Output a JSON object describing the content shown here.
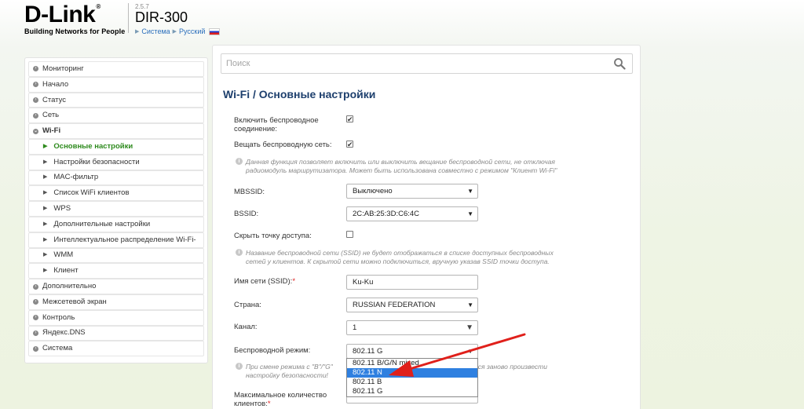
{
  "header": {
    "logo": "D-Link",
    "logo_reg": "®",
    "tagline": "Building Networks for People",
    "version": "2.5.7",
    "model": "DIR-300",
    "link_system": "Система",
    "link_language": "Русский"
  },
  "sidebar": {
    "items": [
      {
        "label": "Мониторинг"
      },
      {
        "label": "Начало"
      },
      {
        "label": "Статус"
      },
      {
        "label": "Сеть"
      },
      {
        "label": "Wi-Fi"
      },
      {
        "label": "Основные настройки"
      },
      {
        "label": "Настройки безопасности"
      },
      {
        "label": "MAC-фильтр"
      },
      {
        "label": "Список WiFi клиентов"
      },
      {
        "label": "WPS"
      },
      {
        "label": "Дополнительные настройки"
      },
      {
        "label": "Интеллектуальное распределение Wi-Fi-"
      },
      {
        "label": "WMM"
      },
      {
        "label": "Клиент"
      },
      {
        "label": "Дополнительно"
      },
      {
        "label": "Межсетевой экран"
      },
      {
        "label": "Контроль"
      },
      {
        "label": "Яндекс.DNS"
      },
      {
        "label": "Система"
      }
    ]
  },
  "search": {
    "placeholder": "Поиск"
  },
  "page": {
    "title": "Wi-Fi /  Основные настройки"
  },
  "form": {
    "enable_label_1": "Включить беспроводное",
    "enable_label_2": "соединение:",
    "enable_checked": "✔",
    "broadcast_label": "Вещать беспроводную сеть:",
    "broadcast_checked": "✔",
    "broadcast_hint_1": "Данная функция позволяет включить или выключить вещание беспроводной сети, не отключая",
    "broadcast_hint_2": "радиомодуль маршрутизатора. Может быть использована совместно с режимом \"Клиент Wi-Fi\"",
    "mbssid_label": "MBSSID:",
    "mbssid_value": "Выключено",
    "bssid_label": "BSSID:",
    "bssid_value": "2C:AB:25:3D:C6:4C",
    "hide_label": "Скрыть точку доступа:",
    "hide_hint_1": "Название беспроводной сети (SSID) не будет отображаться в списке доступных беспроводных",
    "hide_hint_2": "сетей у клиентов. К скрытой сети можно подключиться, вручную указав SSID точки доступа.",
    "ssid_label": "Имя сети (SSID):",
    "ssid_required": "*",
    "ssid_value": "Ku-Ku",
    "country_label": "Страна:",
    "country_value": "RUSSIAN FEDERATION",
    "channel_label": "Канал:",
    "channel_value": "1",
    "mode_label": "Беспроводной режим:",
    "mode_value": "802.11 G",
    "mode_hint_1a": "При смене режима с \"B\"/\"G\"",
    "mode_hint_1b": "тся заново произвести",
    "mode_hint_2": "настройку безопасности!",
    "max_clients_label_1": "Максимальное количество",
    "max_clients_label_2": "клиентов:",
    "max_clients_required": "*"
  },
  "mode_options": [
    "802.11 B/G/N mixed",
    "802.11 N",
    "802.11 B",
    "802.11 G"
  ],
  "mode_highlighted": "802.11 N",
  "colors": {
    "title": "#1d3f6d",
    "active_nav": "#2d8a1d",
    "highlight": "#2f80e0",
    "annotation_arrow": "#e0201b"
  }
}
